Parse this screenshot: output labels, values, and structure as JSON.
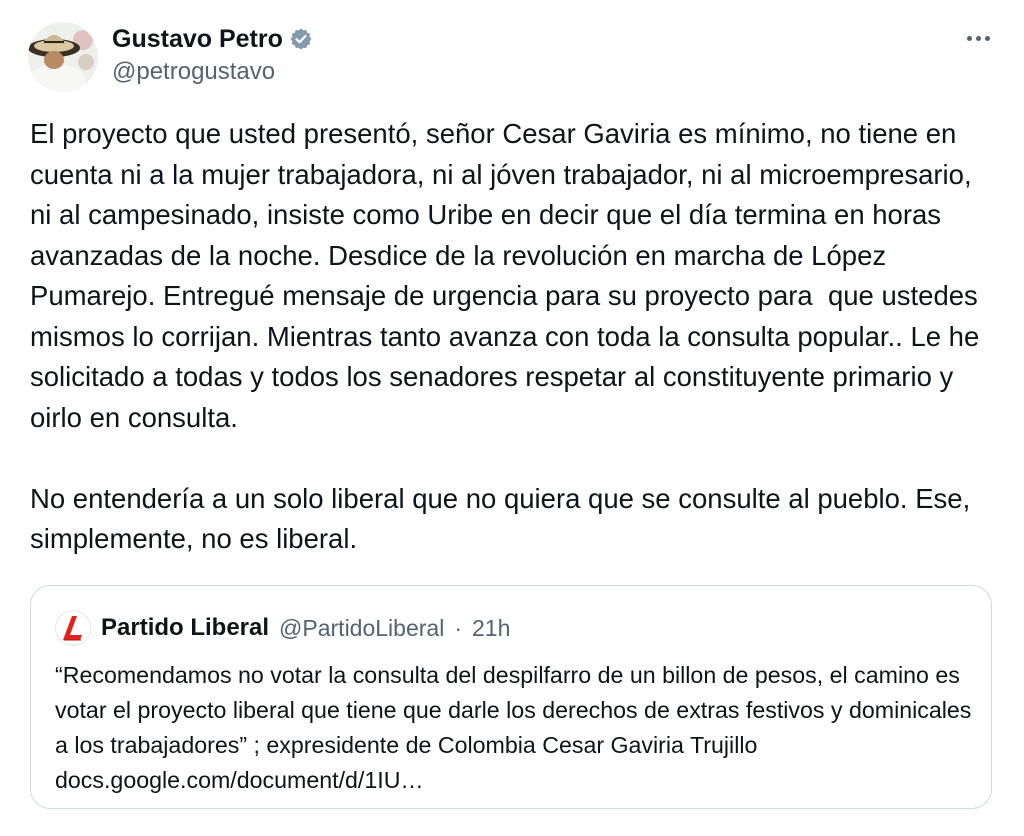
{
  "author": {
    "name": "Gustavo Petro",
    "handle": "@petrogustavo",
    "verified": true,
    "avatar": "avatar-photo"
  },
  "menu": {
    "icon": "more-horizontal-icon"
  },
  "tweet": {
    "text": "El proyecto que usted presentó, señor Cesar Gaviria es mínimo, no tiene en cuenta ni a la mujer trabajadora, ni al jóven trabajador, ni al microempresario, ni al campesinado, insiste como Uribe en decir que el día termina en horas avanzadas de la noche. Desdice de la revolución en marcha de López Pumarejo. Entregué mensaje de urgencia para su proyecto para  que ustedes mismos lo corrijan. Mientras tanto avanza con toda la consulta popular.. Le he solicitado a todas y todos los senadores respetar al constituyente primario y oirlo en consulta.\n\nNo entendería a un solo liberal que no quiera que se consulte al pueblo. Ese, simplemente, no es liberal."
  },
  "quote": {
    "name": "Partido Liberal",
    "handle": "@PartidoLiberal",
    "separator": "·",
    "time": "21h",
    "logo": "partido-liberal-logo",
    "text": "“Recomendamos no votar la consulta del despilfarro de un billon de pesos, el camino es votar el proyecto liberal que tiene que darle los derechos de extras festivos y dominicales a los trabajadores” ; expresidente de Colombia Cesar Gaviria Trujillo docs.google.com/document/d/1IU…"
  },
  "colors": {
    "text": "#0f1419",
    "secondary": "#536471",
    "border": "#cfd9de",
    "verified": "#829aab",
    "logo_red": "#e4201f"
  }
}
